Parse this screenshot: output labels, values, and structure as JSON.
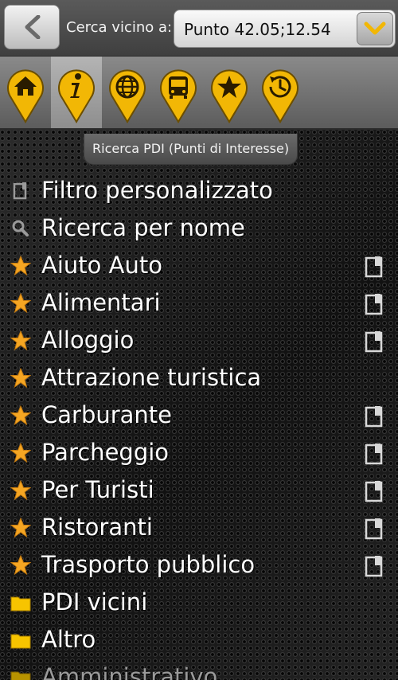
{
  "header": {
    "back_label": "back",
    "near_label": "Cerca vicino a:",
    "location_value": "Punto 42.05;12.54"
  },
  "categories": [
    {
      "id": "home",
      "icon": "home-icon"
    },
    {
      "id": "info",
      "icon": "info-icon",
      "selected": true
    },
    {
      "id": "globe",
      "icon": "globe-icon"
    },
    {
      "id": "bus",
      "icon": "bus-icon"
    },
    {
      "id": "star",
      "icon": "star-icon"
    },
    {
      "id": "history",
      "icon": "clock-icon"
    }
  ],
  "tooltip": "Ricerca PDI (Punti di Interesse)",
  "list": {
    "filter_label": "Filtro personalizzato",
    "search_label": "Ricerca per nome",
    "items": [
      {
        "label": "Aiuto Auto",
        "icon": "star-icon"
      },
      {
        "label": "Alimentari",
        "icon": "star-icon"
      },
      {
        "label": "Alloggio",
        "icon": "star-icon"
      },
      {
        "label": "Attrazione turistica",
        "icon": "star-icon"
      },
      {
        "label": "Carburante",
        "icon": "star-icon"
      },
      {
        "label": "Parcheggio",
        "icon": "star-icon"
      },
      {
        "label": "Per Turisti",
        "icon": "star-icon"
      },
      {
        "label": "Ristoranti",
        "icon": "star-icon"
      },
      {
        "label": "Trasporto pubblico",
        "icon": "star-icon"
      }
    ],
    "folders": [
      {
        "label": "PDI vicini",
        "icon": "folder-icon"
      },
      {
        "label": "Altro",
        "icon": "folder-icon"
      },
      {
        "label": "Amministrativo",
        "icon": "folder-icon"
      }
    ]
  },
  "colors": {
    "accent": "#f2b705",
    "pin_outline": "#6b4e00",
    "star": "#f5a623",
    "folder": "#f7c400"
  }
}
